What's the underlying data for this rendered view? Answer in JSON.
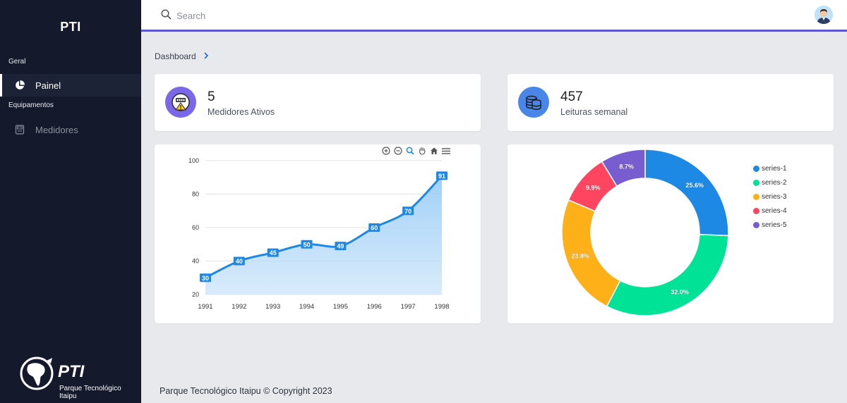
{
  "sidebar": {
    "brand": "PTI",
    "sections": [
      {
        "label": "Geral"
      },
      {
        "label": "Equipamentos"
      }
    ],
    "items": [
      {
        "label": "Painel",
        "icon": "pie-chart-icon",
        "active": true
      },
      {
        "label": "Medidores",
        "icon": "meter-icon",
        "active": false
      }
    ],
    "footer_logo": {
      "name": "PTI",
      "line1": "Parque Tecnológico",
      "line2": "Itaipu"
    }
  },
  "topbar": {
    "search_placeholder": "Search",
    "accent_color": "#5a58d6"
  },
  "breadcrumb": {
    "label": "Dashboard"
  },
  "stats": [
    {
      "value": "5",
      "label": "Medidores Ativos",
      "icon": "meter-warning-icon",
      "color": "#7b68e8"
    },
    {
      "value": "457",
      "label": "Leituras semanal",
      "icon": "database-icon",
      "color": "#4a86e8"
    }
  ],
  "line_chart": {
    "chart_data": {
      "type": "area",
      "categories": [
        "1991",
        "1992",
        "1993",
        "1994",
        "1995",
        "1996",
        "1997",
        "1998"
      ],
      "values": [
        30,
        40,
        45,
        50,
        49,
        60,
        70,
        91
      ],
      "yticks": [
        "100",
        "80",
        "60",
        "40",
        "20"
      ],
      "ylim": [
        20,
        100
      ],
      "data_labels": true,
      "color": "#1e88e5"
    }
  },
  "donut_chart": {
    "chart_data": {
      "type": "pie",
      "donut": true,
      "series": [
        {
          "name": "series-1",
          "percent": "25.6%",
          "value": 25.6,
          "color": "#1e88e5"
        },
        {
          "name": "series-2",
          "percent": "32.0%",
          "value": 32.0,
          "color": "#00e396"
        },
        {
          "name": "series-3",
          "percent": "23.8%",
          "value": 23.8,
          "color": "#feb019"
        },
        {
          "name": "series-4",
          "percent": "9.9%",
          "value": 9.9,
          "color": "#ff4560"
        },
        {
          "name": "series-5",
          "percent": "8.7%",
          "value": 8.7,
          "color": "#775dd0"
        }
      ],
      "legend_position": "right"
    }
  },
  "footer": {
    "copyright": "Parque Tecnológico Itaipu © Copyright 2023"
  }
}
